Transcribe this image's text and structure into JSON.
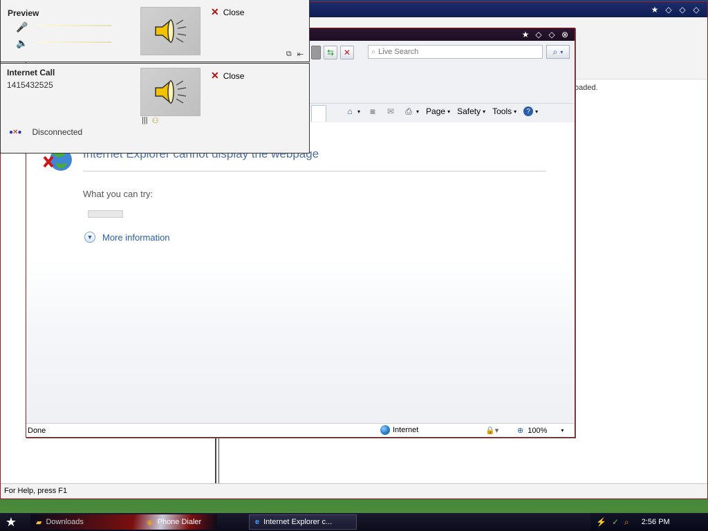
{
  "background_window": {
    "loaded_fragment": "oaded.",
    "status_text": "For Help, press F1"
  },
  "ie": {
    "search_placeholder": "Live Search",
    "commands": {
      "page": "Page",
      "safety": "Safety",
      "tools": "Tools"
    },
    "error_title": "Internet Explorer cannot display the webpage",
    "try_label": "What you can try:",
    "diagnose_button": "",
    "more_info": "More information",
    "status": {
      "done": "Done",
      "zone": "Internet",
      "zoom": "100%"
    }
  },
  "preview_panel": {
    "title": "Preview",
    "close_label": "Close"
  },
  "call_panel": {
    "title": "Internet Call",
    "number": "1415432525",
    "close_label": "Close",
    "status": "Disconnected"
  },
  "taskbar": {
    "items": [
      {
        "label": "Downloads"
      },
      {
        "label": "Phone Dialer"
      },
      {
        "label": "Internet Explorer c..."
      }
    ],
    "clock": "2:56 PM"
  },
  "colors": {
    "ie_border": "#9c1b1b",
    "link_blue": "#2a5caa",
    "error_title": "#4c6fa6",
    "close_x": "#b01010"
  }
}
